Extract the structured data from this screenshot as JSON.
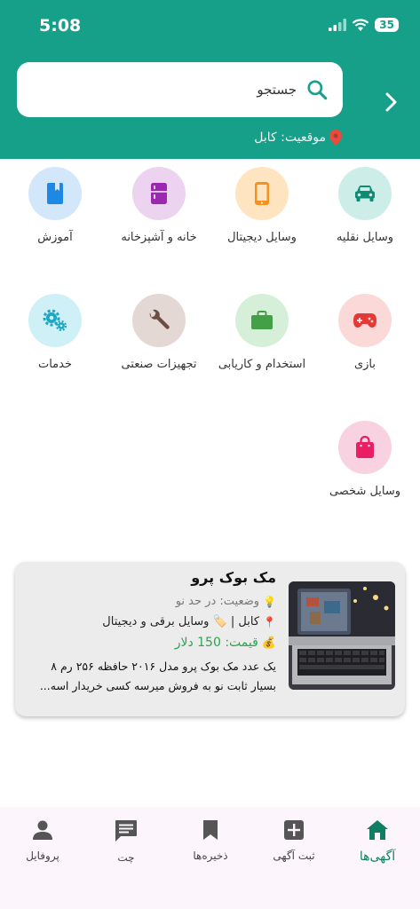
{
  "status_bar": {
    "time": "5:08",
    "battery": "35"
  },
  "header": {
    "search_placeholder": "جستجو",
    "location": "موقعیت: کابل"
  },
  "categories": [
    {
      "label": "وسایل نقلیه",
      "icon": "car-icon",
      "bg": "#cdeee8",
      "color": "#0f8a74"
    },
    {
      "label": "وسایل دیجیتال",
      "icon": "phone-icon",
      "bg": "#ffe4c2",
      "color": "#f39221"
    },
    {
      "label": "خانه و آشپزخانه",
      "icon": "fridge-icon",
      "bg": "#ecd3f0",
      "color": "#9c27b0"
    },
    {
      "label": "آموزش",
      "icon": "book-icon",
      "bg": "#d3e7fb",
      "color": "#1e88e5"
    },
    {
      "label": "بازی",
      "icon": "gamepad-icon",
      "bg": "#fbd9d9",
      "color": "#e53935"
    },
    {
      "label": "استخدام و کاریابی",
      "icon": "briefcase-icon",
      "bg": "#d6efd8",
      "color": "#43a047"
    },
    {
      "label": "تجهیزات صنعتی",
      "icon": "wrench-icon",
      "bg": "#e4d8d4",
      "color": "#6d4c41"
    },
    {
      "label": "خدمات",
      "icon": "gears-icon",
      "bg": "#cff0f7",
      "color": "#1aa6c4"
    },
    {
      "label": "وسایل شخصی",
      "icon": "bag-icon",
      "bg": "#f9d2e1",
      "color": "#e91e63"
    }
  ],
  "listing": {
    "title": "مک بوک پرو",
    "status": "وضعیت: در حد نو",
    "location_category": "کابل | 🏷️ وسایل برقی و دیجیتال",
    "price": "قیمت: 150 دلار",
    "description": "یک عدد مک بوک پرو مدل ۲۰۱۶ حافظه ۲۵۶ رم ۸ بسیار ثابت نو به فروش میرسه کسی خریدار اسه..."
  },
  "bottom_nav": [
    {
      "label": "آگهی‌ها",
      "icon": "home-icon",
      "active": true
    },
    {
      "label": "ثبت آگهی",
      "icon": "add-box-icon",
      "active": false
    },
    {
      "label": "ذخیره‌ها",
      "icon": "bookmark-icon",
      "active": false
    },
    {
      "label": "چت",
      "icon": "chat-icon",
      "active": false
    },
    {
      "label": "پروفایل",
      "icon": "person-icon",
      "active": false
    }
  ],
  "colors": {
    "primary": "#16a08a",
    "active_nav": "#0f7e62",
    "price": "#2aa44f"
  }
}
